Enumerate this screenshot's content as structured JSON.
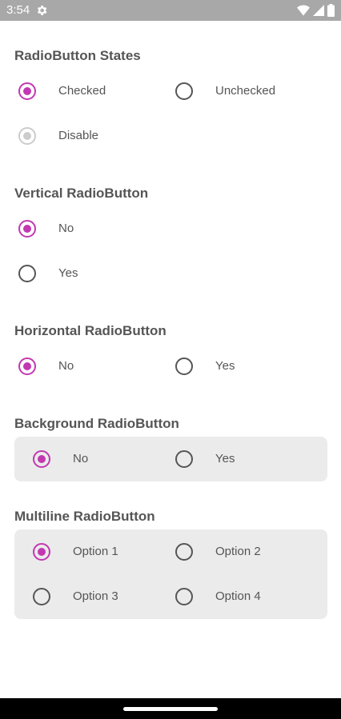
{
  "status_bar": {
    "time": "3:54",
    "icons": [
      "gear-icon",
      "wifi-icon",
      "signal-icon",
      "battery-icon"
    ]
  },
  "colors": {
    "accent": "#c238b1",
    "disabled": "#cccccc",
    "panel": "#ebebeb",
    "text": "#555555"
  },
  "sections": {
    "states": {
      "title": "RadioButton States",
      "checked": {
        "label": "Checked",
        "state": "checked"
      },
      "unchecked": {
        "label": "Unchecked",
        "state": "unchecked"
      },
      "disabled": {
        "label": "Disable",
        "state": "disabled-checked"
      }
    },
    "vertical": {
      "title": "Vertical RadioButton",
      "options": [
        {
          "label": "No",
          "state": "checked"
        },
        {
          "label": "Yes",
          "state": "unchecked"
        }
      ]
    },
    "horizontal": {
      "title": "Horizontal RadioButton",
      "options": [
        {
          "label": "No",
          "state": "checked"
        },
        {
          "label": "Yes",
          "state": "unchecked"
        }
      ]
    },
    "background": {
      "title": "Background RadioButton",
      "options": [
        {
          "label": "No",
          "state": "checked"
        },
        {
          "label": "Yes",
          "state": "unchecked"
        }
      ]
    },
    "multiline": {
      "title": "Multiline RadioButton",
      "options": [
        {
          "label": "Option 1",
          "state": "checked"
        },
        {
          "label": "Option 2",
          "state": "unchecked"
        },
        {
          "label": "Option 3",
          "state": "unchecked"
        },
        {
          "label": "Option 4",
          "state": "unchecked"
        }
      ]
    }
  }
}
